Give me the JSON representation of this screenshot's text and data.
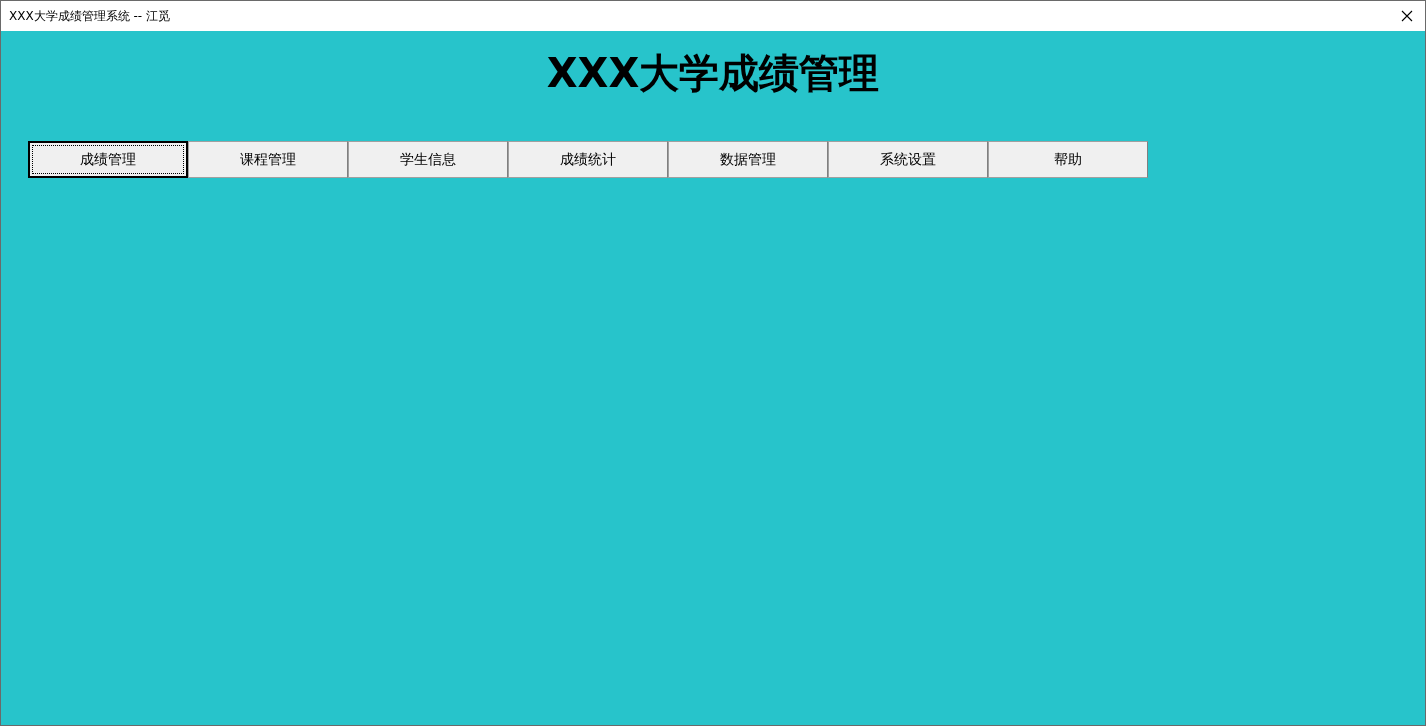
{
  "window": {
    "title": "XXX大学成绩管理系统 -- 江觅"
  },
  "heading": "XXX大学成绩管理",
  "menu_buttons": [
    {
      "label": "成绩管理",
      "selected": true
    },
    {
      "label": "课程管理",
      "selected": false
    },
    {
      "label": "学生信息",
      "selected": false
    },
    {
      "label": "成绩统计",
      "selected": false
    },
    {
      "label": "数据管理",
      "selected": false
    },
    {
      "label": "系统设置",
      "selected": false
    },
    {
      "label": "帮助",
      "selected": false
    }
  ]
}
